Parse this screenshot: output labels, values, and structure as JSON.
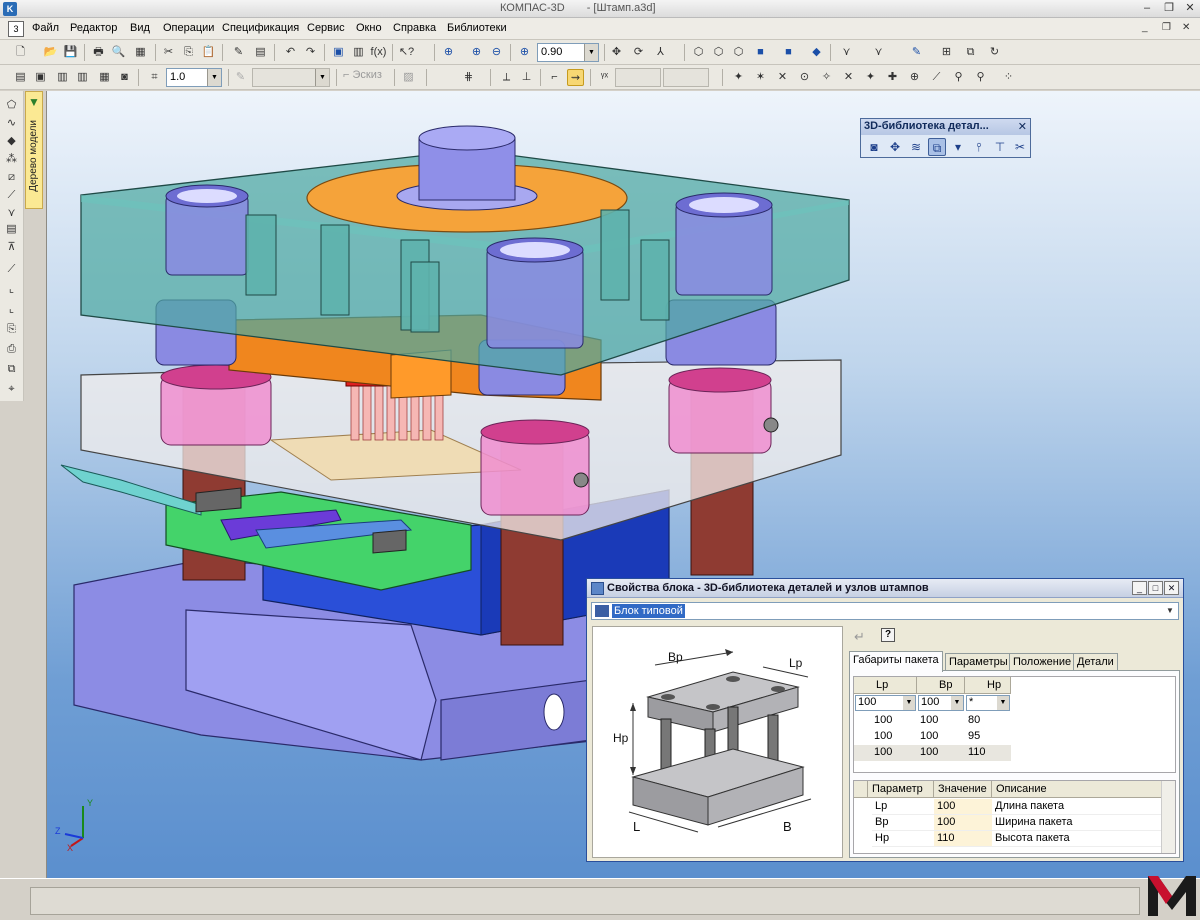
{
  "window": {
    "app_name": "КОМПАС-3D",
    "doc_name": "- [Штамп.a3d]"
  },
  "menu": [
    "Файл",
    "Редактор",
    "Вид",
    "Операции",
    "Спецификация",
    "Сервис",
    "Окно",
    "Справка",
    "Библиотеки"
  ],
  "toolbar1": {
    "zoom_value": "0.90"
  },
  "toolbar2": {
    "step_value": "1.0",
    "sketch_label": "Эскиз"
  },
  "tree_tab": {
    "label": "Дерево модели"
  },
  "library_panel": {
    "title": "3D-библиотека детал..."
  },
  "dialog": {
    "title": "Свойства блока - 3D-библиотека деталей и узлов штампов",
    "type_value": "Блок типовой",
    "tabs": [
      "Габариты пакета",
      "Параметры",
      "Положение",
      "Детали"
    ],
    "active_tab": "Габариты пакета",
    "preview_labels": {
      "bp": "Bp",
      "lp": "Lp",
      "hp": "Hp",
      "l": "L",
      "b": "B"
    },
    "size_table": {
      "headers": [
        "Lp",
        "Bp",
        "Hp"
      ],
      "filter": [
        "100",
        "100",
        "*"
      ],
      "rows": [
        [
          "100",
          "100",
          "80"
        ],
        [
          "100",
          "100",
          "95"
        ],
        [
          "100",
          "100",
          "110"
        ]
      ]
    },
    "param_table": {
      "headers": [
        "Параметр",
        "Значение",
        "Описание"
      ],
      "rows": [
        [
          "Lp",
          "100",
          "Длина пакета"
        ],
        [
          "Bp",
          "100",
          "Ширина пакета"
        ],
        [
          "Hp",
          "110",
          "Высота пакета"
        ]
      ]
    }
  },
  "axes": {
    "x": "X",
    "y": "Y",
    "z": "Z"
  },
  "colors": {
    "viewport_top": "#eef4fb",
    "viewport_bottom": "#5b8fce",
    "top_plate": "#5aa6a0",
    "orange": "#f39a2b",
    "base": "#8f8fe6",
    "pink": "#ee8fcf",
    "column": "#8f3b32",
    "green": "#44d36a",
    "logo": "#c8102e"
  }
}
